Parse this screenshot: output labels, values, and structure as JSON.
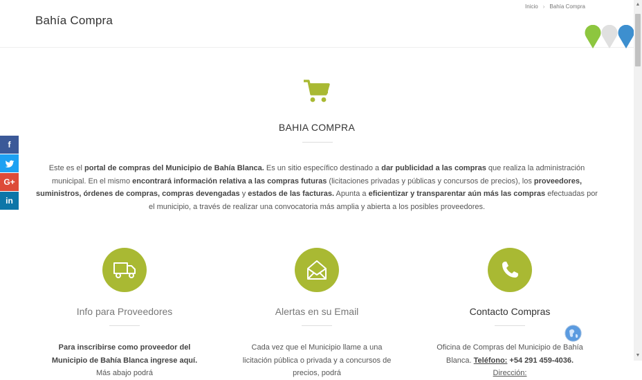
{
  "header": {
    "title": "Bahía Compra",
    "breadcrumb": {
      "home": "Inicio",
      "separator": "›",
      "current": "Bahía Compra"
    }
  },
  "colors": {
    "accent": "#a9b933",
    "pin_green": "#8dc63f",
    "pin_gray": "#e0e0e0",
    "pin_blue": "#3d8fcf",
    "facebook": "#3b5998",
    "twitter": "#1da1f2",
    "google_plus": "#dd4b39",
    "linkedin": "#0e76a8"
  },
  "section": {
    "icon": "shopping-cart-icon",
    "heading": "BAHIA COMPRA",
    "intro": [
      {
        "t": "Este es el ",
        "b": false
      },
      {
        "t": "portal de compras del Municipio de Bahía Blanca.",
        "b": true
      },
      {
        "t": " Es un sitio específico destinado a ",
        "b": false
      },
      {
        "t": "dar publicidad a las compras",
        "b": true
      },
      {
        "t": " que realiza la administración municipal. En el mismo ",
        "b": false
      },
      {
        "t": "encontrará información relativa a las compras futuras",
        "b": true
      },
      {
        "t": " (licitaciones privadas y públicas y concursos de precios), los ",
        "b": false
      },
      {
        "t": "proveedores, suministros, órdenes de compras, compras devengadas",
        "b": true
      },
      {
        "t": " y ",
        "b": false
      },
      {
        "t": "estados de las facturas.",
        "b": true
      },
      {
        "t": " Apunta a ",
        "b": false
      },
      {
        "t": "eficientizar y transparentar aún más las compras",
        "b": true
      },
      {
        "t": " efectuadas por el municipio, a través de realizar una convocatoria más amplia y abierta a los posibles proveedores.",
        "b": false
      }
    ]
  },
  "share": [
    {
      "label": "f",
      "icon": "facebook-icon"
    },
    {
      "label": "t",
      "icon": "twitter-icon"
    },
    {
      "label": "G+",
      "icon": "google-plus-icon"
    },
    {
      "label": "in",
      "icon": "linkedin-icon"
    }
  ],
  "features": [
    {
      "icon": "truck-icon",
      "title": "Info para Proveedores",
      "text": [
        {
          "t": "Para inscribirse como proveedor del Municipio de Bahía Blanca ingrese aquí.",
          "b": true
        },
        {
          "t": " Más abajo podrá",
          "b": false
        }
      ]
    },
    {
      "icon": "envelope-icon",
      "title": "Alertas en su Email",
      "text": [
        {
          "t": "Cada vez que el Municipio llame a una licitación pública o privada y a concursos de precios, podrá",
          "b": false
        }
      ]
    },
    {
      "icon": "phone-icon",
      "title": "Contacto Compras",
      "text": [
        {
          "t": "Oficina de Compras del Municipio de Bahía Blanca. ",
          "b": false
        },
        {
          "t": "Teléfono:",
          "b": true,
          "u": true
        },
        {
          "t": " +54 291 459-4036.",
          "b": true
        },
        {
          "t": " ",
          "b": false
        },
        {
          "t": "Dirección:",
          "b": false,
          "u": true
        }
      ]
    }
  ]
}
